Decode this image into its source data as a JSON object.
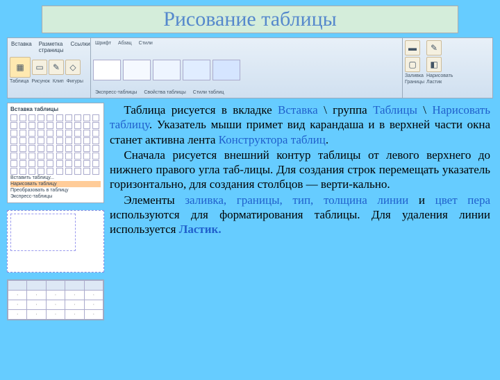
{
  "title": "Рисование таблицы",
  "ribbon": {
    "left_tabs": [
      "Вставка",
      "Разметка страницы",
      "Ссылки"
    ],
    "label_table": "Таблица",
    "label_pic": "Рисунок",
    "label_clip": "Клип",
    "label_shape": "Фигуры",
    "mid_items": [
      "Шрифт",
      "Абзац",
      "Стили",
      "Экспресс-таблицы",
      "Свойства таблицы",
      "Стили таблиц"
    ],
    "right_items": [
      "Заливка",
      "Границы",
      "Нарисовать",
      "Ластик"
    ]
  },
  "panel": {
    "title": "Вставка таблицы",
    "links": [
      "Вставить таблицу...",
      "Нарисовать таблицу",
      "Преобразовать в таблицу",
      "Экспресс-таблицы"
    ]
  },
  "text": {
    "p1_a": "Таблица рисуется в вкладке ",
    "p1_b": "Вставка",
    "p1_c": " \\ группа ",
    "p1_d": "Таблицы",
    "p1_e": " \\ ",
    "p1_f": "Нарисовать таблицу",
    "p1_g": ". Указатель мыши примет вид карандаша и в верхней части окна станет активна лента ",
    "p1_h": "Конструктора таблиц",
    "p1_i": ".",
    "p2": "Сначала рисуется внешний контур таблицы от левого верхнего до нижнего правого угла таб-лицы. Для создания строк перемещать указатель горизонтально, для создания столбцов — верти-кально.",
    "p3_a": "Элементы ",
    "p3_b": "заливка, границы, тип, толщина линии",
    "p3_c": " и ",
    "p3_d": "цвет пера",
    "p3_e": " используются для форматирования таблицы. Для удаления линии используется ",
    "p3_f": "Ластик.",
    "p3_g": ""
  }
}
